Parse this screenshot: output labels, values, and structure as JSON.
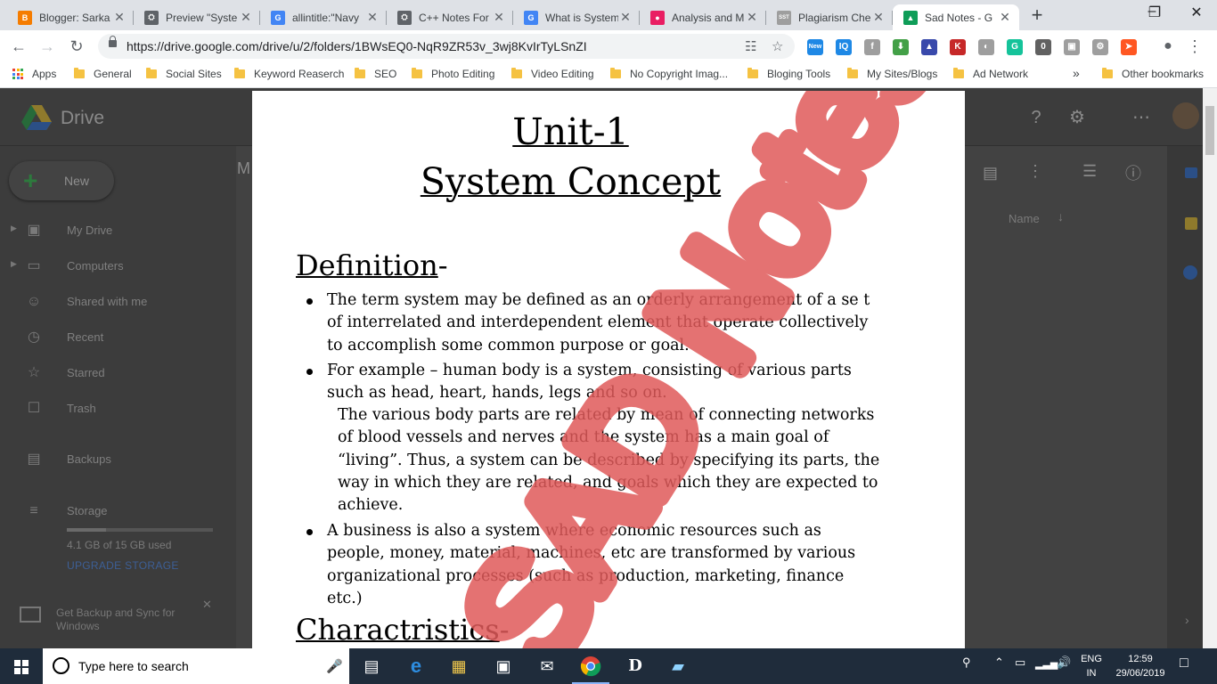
{
  "browser": {
    "tabs": [
      {
        "title": "Blogger: Sarka",
        "favicon_color": "#f57c00",
        "favicon_glyph": "B"
      },
      {
        "title": "Preview \"Syste",
        "favicon_color": "#5f6368",
        "favicon_glyph": "⛭"
      },
      {
        "title": "allintitle:\"Navy",
        "favicon_color": "#4285f4",
        "favicon_glyph": "G"
      },
      {
        "title": "C++ Notes For",
        "favicon_color": "#5f6368",
        "favicon_glyph": "⛭"
      },
      {
        "title": "What is System",
        "favicon_color": "#4285f4",
        "favicon_glyph": "G"
      },
      {
        "title": "Analysis and M",
        "favicon_color": "#e91e63",
        "favicon_glyph": "●"
      },
      {
        "title": "Plagiarism Che",
        "favicon_color": "#9e9e9e",
        "favicon_glyph": "SST"
      },
      {
        "title": "Sad Notes - G",
        "favicon_color": "#0f9d58",
        "favicon_glyph": "▲"
      }
    ],
    "active_tab_index": 7,
    "new_tab_glyph": "+",
    "url": "https://drive.google.com/drive/u/2/folders/1BWsEQ0-NqR9ZR53v_3wj8KvIrTyLSnZI",
    "window_controls": {
      "minimize": "–",
      "restore": "❐",
      "close": "✕"
    },
    "extensions": [
      {
        "label": "New",
        "color": "#1e88e5"
      },
      {
        "label": "IQ",
        "color": "#1e88e5"
      },
      {
        "label": "f",
        "color": "#9e9e9e"
      },
      {
        "label": "⬇",
        "color": "#43a047"
      },
      {
        "label": "▲",
        "color": "#3949ab"
      },
      {
        "label": "K",
        "color": "#c62828"
      },
      {
        "label": "◐",
        "color": "#9e9e9e"
      },
      {
        "label": "G",
        "color": "#15c39a"
      },
      {
        "label": "0",
        "color": "#616161"
      },
      {
        "label": "▣",
        "color": "#9e9e9e"
      },
      {
        "label": "⚙",
        "color": "#9e9e9e"
      },
      {
        "label": "➤",
        "color": "#ff5722"
      }
    ]
  },
  "bookmarks": {
    "apps_label": "Apps",
    "items": [
      "General",
      "Social Sites",
      "Keyword Reaserch",
      "SEO",
      "Photo Editing",
      "Video Editing",
      "No Copyright Imag...",
      "Bloging Tools",
      "My Sites/Blogs",
      "Ad Network"
    ],
    "overflow": "»",
    "other": "Other bookmarks"
  },
  "drive": {
    "app_name": "Drive",
    "new_label": "New",
    "nav": [
      {
        "label": "My Drive",
        "icon": "drive-icon",
        "glyph": "▣",
        "arrow": true
      },
      {
        "label": "Computers",
        "icon": "computer-icon",
        "glyph": "▭",
        "arrow": true
      },
      {
        "label": "Shared with me",
        "icon": "people-icon",
        "glyph": "☺",
        "arrow": false
      },
      {
        "label": "Recent",
        "icon": "clock-icon",
        "glyph": "◷",
        "arrow": false
      },
      {
        "label": "Starred",
        "icon": "star-icon",
        "glyph": "☆",
        "arrow": false
      },
      {
        "label": "Trash",
        "icon": "trash-icon",
        "glyph": "☐",
        "arrow": false
      },
      {
        "label": "Backups",
        "icon": "backup-icon",
        "glyph": "▤",
        "arrow": false
      },
      {
        "label": "Storage",
        "icon": "storage-icon",
        "glyph": "≡",
        "arrow": false
      }
    ],
    "storage_used": "4.1 GB of 15 GB used",
    "storage_fraction": 0.27,
    "upgrade_label": "UPGRADE STORAGE",
    "backup_sync": "Get Backup and Sync for Windows",
    "sort_label": "Name",
    "breadcrumb_initial": "M"
  },
  "document": {
    "title_line1": "Unit-1",
    "title_line2": "System Concept",
    "definition_heading": "Definition",
    "definition_dash": "-",
    "bullets": [
      "The term system may be defined as an orderly arrangement of a se t of interrelated and interdependent element that operate collectively to accomplish some common purpose or goal.",
      "For example – human body is a system, consisting of various parts such as head, heart, hands, legs and so on.",
      " A business is also a system where economic resources such as people, money, material, machines, etc are transformed by various organizational processes (such as production, marketing, finance etc.)"
    ],
    "example_paragraph": "The various body parts are related by mean of connecting networks of blood vessels and nerves and the system has a main goal of “living”. Thus, a system can be described by specifying its parts, the way in which they are related, and goals which they are expected to achieve.",
    "characteristics_heading": "Charactristics",
    "characteristics_dash": "-",
    "watermark": "SAD Notes",
    "watermark_color": "#e05a5a"
  },
  "taskbar": {
    "search_placeholder": "Type here to search",
    "language_line1": "ENG",
    "language_line2": "IN",
    "time": "12:59",
    "date": "29/06/2019"
  }
}
